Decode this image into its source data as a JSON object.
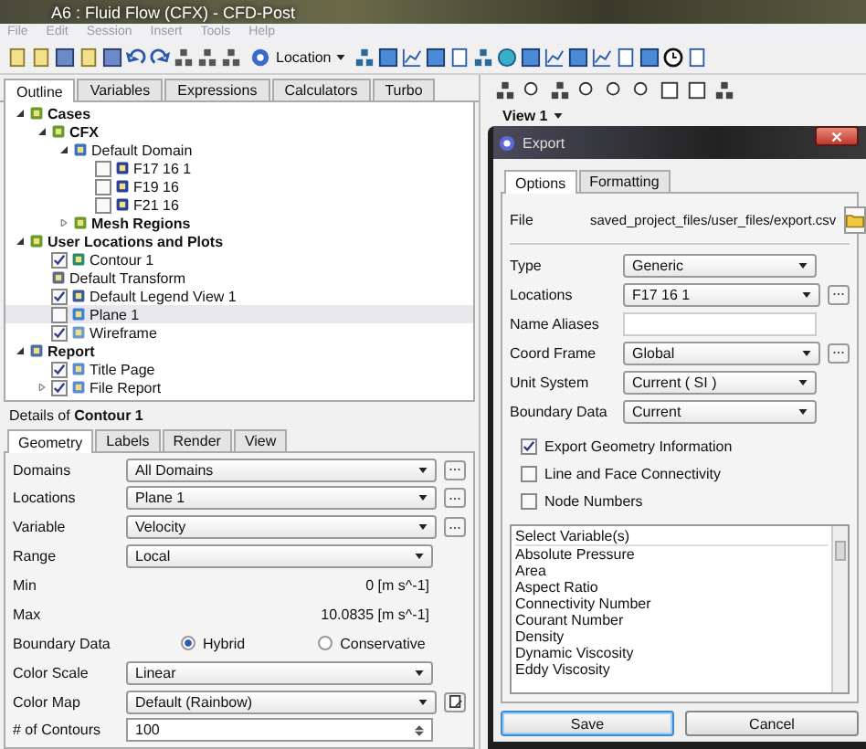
{
  "window": {
    "title": "A6 : Fluid Flow (CFX) - CFD-Post"
  },
  "menu": [
    "File",
    "Edit",
    "Session",
    "Insert",
    "Tools",
    "Help"
  ],
  "toolbar": {
    "location": "Location"
  },
  "outline_tabs": [
    {
      "label": "Outline",
      "selected": true
    },
    {
      "label": "Variables",
      "selected": false
    },
    {
      "label": "Expressions",
      "selected": false
    },
    {
      "label": "Calculators",
      "selected": false
    },
    {
      "label": "Turbo",
      "selected": false
    }
  ],
  "tree": [
    {
      "label": "Cases",
      "kind": "group",
      "expanded": true,
      "selected": false,
      "children": [
        {
          "label": "CFX",
          "kind": "group",
          "expanded": true,
          "selected": false,
          "children": [
            {
              "label": "Default Domain",
              "kind": "domain",
              "expanded": true,
              "selected": false,
              "children": [
                {
                  "label": "F17 16 1",
                  "kind": "boundary",
                  "checked": false,
                  "selected": false
                },
                {
                  "label": "F19 16",
                  "kind": "boundary",
                  "checked": false,
                  "selected": false
                },
                {
                  "label": "F21 16",
                  "kind": "boundary",
                  "checked": false,
                  "selected": false
                }
              ]
            },
            {
              "label": "Mesh Regions",
              "kind": "group",
              "expanded": false,
              "selected": false
            }
          ]
        }
      ]
    },
    {
      "label": "User Locations and Plots",
      "kind": "group",
      "expanded": true,
      "selected": false,
      "children": [
        {
          "label": "Contour 1",
          "kind": "contour",
          "checked": true,
          "selected": false
        },
        {
          "label": "Default Transform",
          "kind": "transform",
          "selected": false
        },
        {
          "label": "Default Legend View 1",
          "kind": "legend",
          "checked": true,
          "selected": false
        },
        {
          "label": "Plane 1",
          "kind": "plane",
          "checked": false,
          "selected": true
        },
        {
          "label": "Wireframe",
          "kind": "wireframe",
          "checked": true,
          "selected": false
        }
      ]
    },
    {
      "label": "Report",
      "kind": "report",
      "expanded": true,
      "selected": false,
      "children": [
        {
          "label": "Title Page",
          "kind": "page",
          "checked": true,
          "selected": false
        },
        {
          "label": "File Report",
          "kind": "page",
          "checked": true,
          "expanded": false,
          "selected": false
        }
      ]
    }
  ],
  "details": {
    "title": "Details of **Contour 1**",
    "tabs": [
      {
        "label": "Geometry",
        "selected": true
      },
      {
        "label": "Labels",
        "selected": false
      },
      {
        "label": "Render",
        "selected": false
      },
      {
        "label": "View",
        "selected": false
      }
    ],
    "fields": [
      {
        "kind": "select",
        "label": "Domains",
        "value": "All Domains",
        "more_button": true
      },
      {
        "kind": "select",
        "label": "Locations",
        "value": "Plane 1",
        "more_button": true
      },
      {
        "kind": "select",
        "label": "Variable",
        "value": "Velocity",
        "more_button": true
      },
      {
        "kind": "select",
        "label": "Range",
        "value": "Local"
      },
      {
        "kind": "reading",
        "label": "Min",
        "value": "0 [m s^-1]"
      },
      {
        "kind": "reading",
        "label": "Max",
        "value": "10.0835 [m s^-1]"
      },
      {
        "kind": "radio",
        "label": "Boundary Data",
        "options": [
          {
            "label": "Hybrid",
            "selected": true
          },
          {
            "label": "Conservative",
            "selected": false
          }
        ]
      },
      {
        "kind": "select",
        "label": "Color Scale",
        "value": "Linear"
      },
      {
        "kind": "select",
        "label": "Color Map",
        "value": "Default (Rainbow)",
        "edit_button": true
      },
      {
        "kind": "spin",
        "label": "# of Contours",
        "value": "100"
      }
    ]
  },
  "view": {
    "label": "View 1"
  },
  "export_dialog": {
    "title": "Export",
    "tabs": [
      {
        "label": "Options",
        "selected": true
      },
      {
        "label": "Formatting",
        "selected": false
      }
    ],
    "file": {
      "label": "File",
      "value": "saved_project_files/user_files/export.csv"
    },
    "fields": [
      {
        "kind": "select",
        "label": "Type",
        "value": "Generic"
      },
      {
        "kind": "select",
        "label": "Locations",
        "value": "F17 16 1",
        "more_button": true
      },
      {
        "kind": "text",
        "label": "Name Aliases"
      },
      {
        "kind": "select",
        "label": "Coord Frame",
        "value": "Global",
        "more_button": true
      },
      {
        "kind": "select",
        "label": "Unit System",
        "value": "Current ( SI )"
      },
      {
        "kind": "select",
        "label": "Boundary Data",
        "value": "Current"
      }
    ],
    "options": [
      {
        "label": "Export Geometry Information",
        "checked": true
      },
      {
        "label": "Line and Face Connectivity",
        "checked": false
      },
      {
        "label": "Node Numbers",
        "checked": false
      }
    ],
    "variables": {
      "header": "Select Variable(s)",
      "items": [
        "Absolute Pressure",
        "Area",
        "Aspect Ratio",
        "Connectivity Number",
        "Courant Number",
        "Density",
        "Dynamic Viscosity",
        "Eddy Viscosity"
      ]
    },
    "buttons": [
      {
        "label": "Save",
        "default": true
      },
      {
        "label": "Cancel",
        "default": false
      }
    ]
  }
}
